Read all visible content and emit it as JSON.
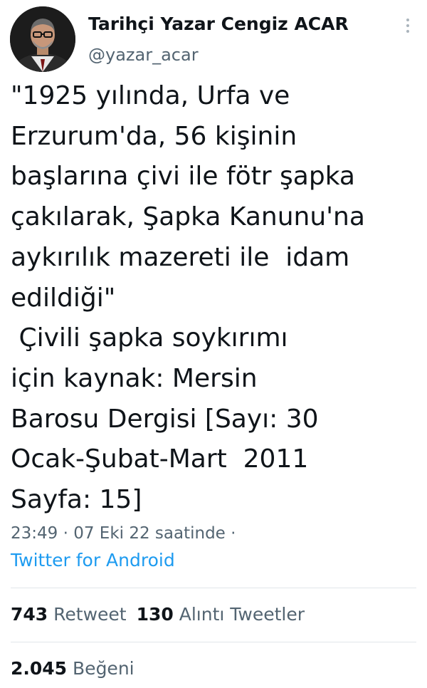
{
  "author": {
    "name": "Tarihçi Yazar Cengiz ACAR",
    "handle": "@yazar_acar"
  },
  "more_icon": "more-vertical-icon",
  "tweet": {
    "text": "\"1925 yılında, Urfa ve\nErzurum'da, 56 kişinin\nbaşlarına çivi ile fötr şapka\nçakılarak, Şapka Kanunu'na\naykırılık mazereti ile  idam\nedildiği\"\n Çivili şapka soykırımı\niçin kaynak: Mersin\nBarosu Dergisi [Sayı: 30\nOcak-Şubat-Mart  2011\nSayfa: 15]",
    "timestamp": "23:49 · 07 Eki 22 saatinde ·",
    "source": "Twitter for Android"
  },
  "stats": {
    "retweets": {
      "count": "743",
      "label": "Retweet"
    },
    "quotes": {
      "count": "130",
      "label": "Alıntı Tweetler"
    },
    "likes": {
      "count": "2.045",
      "label": "Beğeni"
    }
  },
  "colors": {
    "text": "#0f1419",
    "secondary": "#536471",
    "link": "#1d9bf0",
    "divider": "#e1e6ea"
  }
}
